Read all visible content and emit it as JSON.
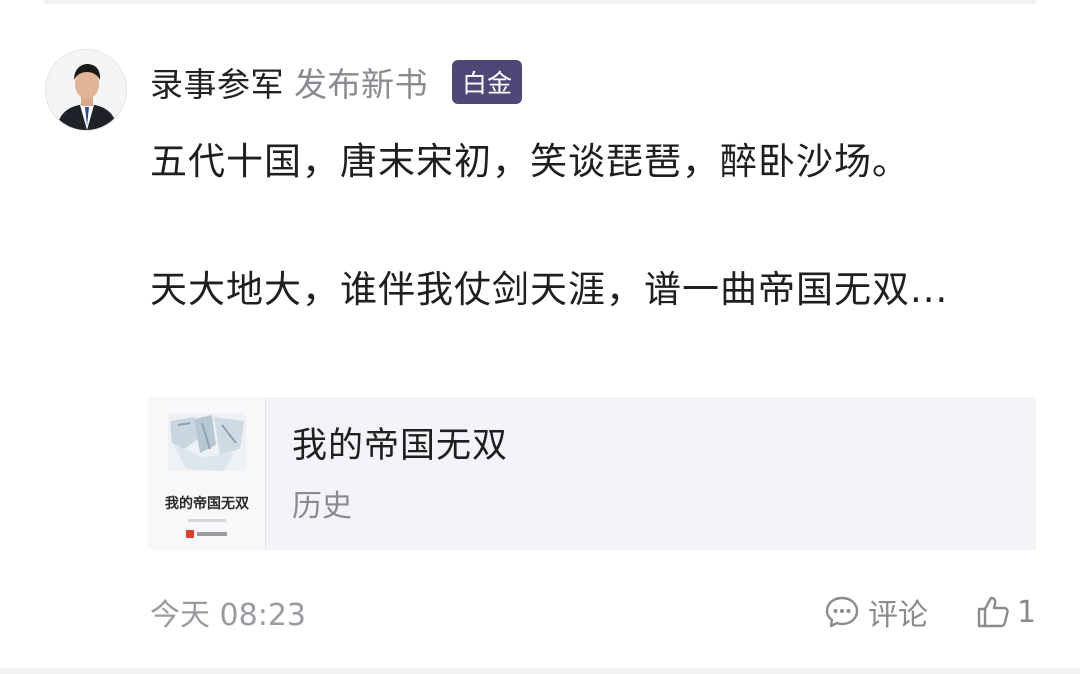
{
  "post": {
    "author": "录事参军",
    "action": "发布新书",
    "badge": "白金",
    "text_line1": "五代十国，唐末宋初，笑谈琵琶，醉卧沙场。",
    "text_line2": "天大地大，谁伴我仗剑天涯，谱一曲帝国无双..."
  },
  "book": {
    "cover_title": "我的帝国无双",
    "title": "我的帝国无双",
    "genre": "历史"
  },
  "footer": {
    "timestamp": "今天 08:23",
    "comment_label": "评论",
    "like_count": "1"
  },
  "icons": {
    "avatar": "author-avatar",
    "comment": "comment-bubble-icon",
    "like": "thumbs-up-icon"
  },
  "colors": {
    "badge_bg": "#4f4775",
    "muted_text": "#8a8a90",
    "card_bg": "#f3f4f8"
  }
}
